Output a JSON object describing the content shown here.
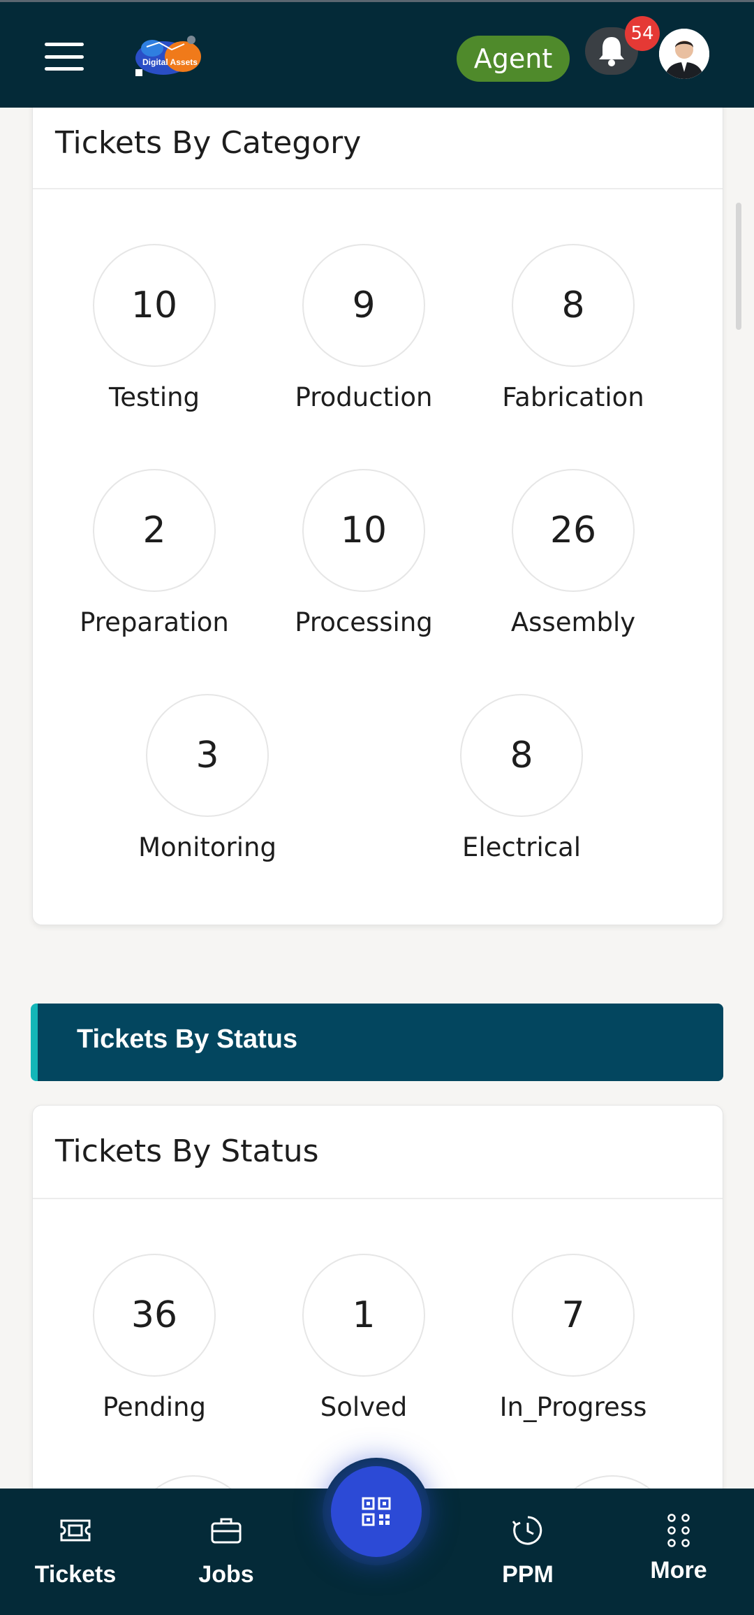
{
  "header": {
    "logo_text": "Digital Assets",
    "role": "Agent",
    "notification_count": "54"
  },
  "category_card": {
    "title": "Tickets By Category",
    "items": [
      {
        "label": "Testing",
        "count": "10"
      },
      {
        "label": "Production",
        "count": "9"
      },
      {
        "label": "Fabrication",
        "count": "8"
      },
      {
        "label": "Preparation",
        "count": "2"
      },
      {
        "label": "Processing",
        "count": "10"
      },
      {
        "label": "Assembly",
        "count": "26"
      },
      {
        "label": "Monitoring",
        "count": "3"
      },
      {
        "label": "Electrical",
        "count": "8"
      }
    ]
  },
  "status_section": {
    "header": "Tickets By Status"
  },
  "status_card": {
    "title": "Tickets By Status",
    "items": [
      {
        "label": "Pending",
        "count": "36"
      },
      {
        "label": "Solved",
        "count": "1"
      },
      {
        "label": "In_Progress",
        "count": "7"
      }
    ]
  },
  "bottom_nav": {
    "items": [
      {
        "label": "Tickets",
        "icon": "ticket-icon"
      },
      {
        "label": "Jobs",
        "icon": "briefcase-icon"
      },
      {
        "label": "PPM",
        "icon": "clock-icon"
      },
      {
        "label": "More",
        "icon": "grid-dots-icon"
      }
    ],
    "center_action_icon": "qr-code-icon"
  },
  "colors": {
    "topbar": "#042a38",
    "role_pill": "#4f8a2b",
    "badge": "#e53935",
    "status_header": "#03465f",
    "status_accent": "#13b6b8",
    "fab": "#2c4ad6"
  }
}
